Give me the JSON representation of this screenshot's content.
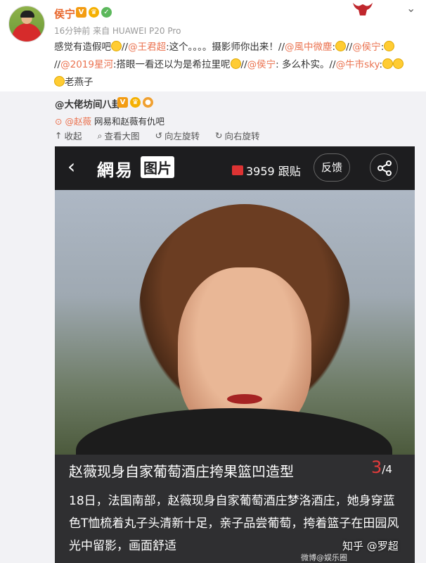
{
  "post": {
    "username": "侯宁",
    "meta": "16分钟前 来自 HUAWEI P20 Pro",
    "segments": [
      {
        "t": "感觉有造假吧",
        "c": "text"
      },
      {
        "t": "emoji",
        "c": "emoji"
      },
      {
        "t": "//",
        "c": "text"
      },
      {
        "t": "@王君超",
        "c": "mention"
      },
      {
        "t": ":这个。。。。摄影师你出来！//",
        "c": "text"
      },
      {
        "t": "@風中微塵",
        "c": "mention"
      },
      {
        "t": ":",
        "c": "text"
      },
      {
        "t": "emoji",
        "c": "emoji"
      },
      {
        "t": "//",
        "c": "text"
      },
      {
        "t": "@侯宁",
        "c": "mention"
      },
      {
        "t": ":",
        "c": "text"
      },
      {
        "t": "emoji",
        "c": "emoji"
      },
      {
        "t": "//",
        "c": "text"
      },
      {
        "t": "@2019星河",
        "c": "mention"
      },
      {
        "t": ":搭眼一看还以为是希拉里呢",
        "c": "text"
      },
      {
        "t": "emoji",
        "c": "emoji"
      },
      {
        "t": "//",
        "c": "text"
      },
      {
        "t": "@侯宁",
        "c": "mention"
      },
      {
        "t": ": 多么朴实。//",
        "c": "text"
      },
      {
        "t": "@牛市sky",
        "c": "mention"
      },
      {
        "t": ":",
        "c": "text"
      },
      {
        "t": "emoji",
        "c": "emoji"
      },
      {
        "t": "emoji",
        "c": "emoji"
      },
      {
        "t": "emoji",
        "c": "emoji"
      },
      {
        "t": "老燕子",
        "c": "text"
      }
    ]
  },
  "repost": {
    "username": "@大佬坊间八卦",
    "tag_line_mention": "@赵薇",
    "tag_line_text": " 网易和赵薇有仇吧",
    "actions": [
      {
        "icon": "collapse-icon",
        "label": "收起"
      },
      {
        "icon": "zoom-icon",
        "label": "查看大图"
      },
      {
        "icon": "rotate-left-icon",
        "label": "向左旋转"
      },
      {
        "icon": "rotate-right-icon",
        "label": "向右旋转"
      }
    ]
  },
  "photo": {
    "logo": "網易",
    "logo_tag": "图片",
    "comments": "3959 跟贴",
    "feedback": "反馈",
    "caption_title": "赵薇现身自家葡萄酒庄挎果篮凹造型",
    "page_current": "3",
    "page_total": "/4",
    "caption_body": "18日，法国南部，赵薇现身自家葡萄酒庄梦洛酒庄，她身穿蓝色T恤梳着丸子头清新十足，亲子品尝葡萄，挎着篮子在田园风光中留影，画面舒适"
  },
  "watermark": "知乎 @罗超",
  "watermark2": "微博@娱乐圈"
}
